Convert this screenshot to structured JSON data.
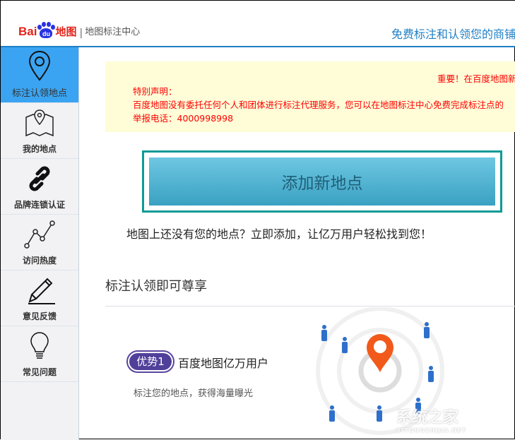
{
  "header": {
    "logo_bai": "Bai",
    "logo_du": "du",
    "logo_ditu": "地图",
    "logo_sep": "|",
    "logo_center": "地图标注中心",
    "slogan": "免费标注和认领您的商铺"
  },
  "sidebar": {
    "items": [
      {
        "label": "标注认领地点",
        "icon": "location-pin-icon",
        "active": true
      },
      {
        "label": "我的地点",
        "icon": "map-icon"
      },
      {
        "label": "品牌连锁认证",
        "icon": "link-icon"
      },
      {
        "label": "访问热度",
        "icon": "line-chart-icon"
      },
      {
        "label": "意见反馈",
        "icon": "pencil-icon"
      },
      {
        "label": "常见问题",
        "icon": "lightbulb-icon"
      }
    ]
  },
  "notice": {
    "important": "重要！在百度地图新",
    "title": "特别声明：",
    "body": "百度地图没有委托任何个人和团体进行标注代理服务，您可以在地图标注中心免费完成标注点的",
    "phone": "举报电话：4000998998"
  },
  "main": {
    "add_button": "添加新地点",
    "tip": "地图上还没有您的地点？立即添加，让亿万用户轻松找到您！",
    "section_title": "标注认领即可尊享",
    "advantage_badge": "优势1",
    "advantage_title": "百度地图亿万用户",
    "advantage_sub": "标注您的地点，获得海量曝光"
  },
  "watermark": {
    "text": "系统之家",
    "sub": "XITONGZHIJIA.NET"
  },
  "colors": {
    "accent": "#1e7fc6",
    "active_nav": "#3aa4f2",
    "button_border": "#0e9a96",
    "pin": "#f15a1a",
    "people": "#2e6fcb",
    "badge": "#50409a"
  }
}
